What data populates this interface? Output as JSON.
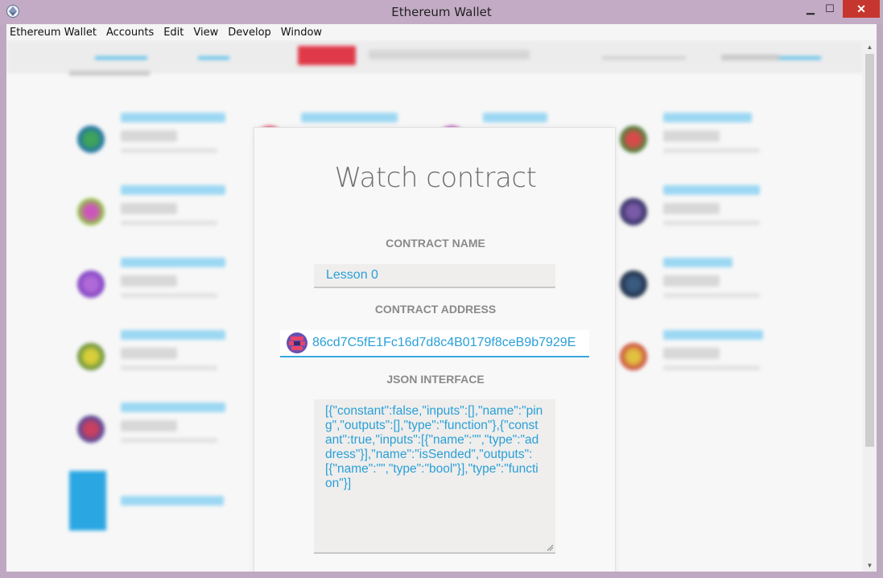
{
  "window": {
    "title": "Ethereum Wallet",
    "minimize_glyph": "▁",
    "maximize_glyph": "☐",
    "close_glyph": "✕"
  },
  "menu": [
    "Ethereum Wallet",
    "Accounts",
    "Edit",
    "View",
    "Develop",
    "Window"
  ],
  "modal": {
    "title": "Watch contract",
    "contract_name_label": "CONTRACT NAME",
    "contract_name_value": "Lesson 0",
    "contract_address_label": "CONTRACT ADDRESS",
    "contract_address_value": "86cd7C5fE1Fc16d7d8c4B0179f8ceB9b7929E",
    "json_interface_label": "JSON INTERFACE",
    "json_interface_value": "[{\"constant\":false,\"inputs\":[],\"name\":\"ping\",\"outputs\":[],\"type\":\"function\"},{\"constant\":true,\"inputs\":[{\"name\":\"\",\"type\":\"address\"}],\"name\":\"isSended\",\"outputs\":[{\"name\":\"\",\"type\":\"bool\"}],\"type\":\"function\"}]"
  },
  "colors": {
    "accent": "#2a9fd8",
    "titlebar": "#c3abc5",
    "close": "#c7362e",
    "label": "#8a8a8a"
  },
  "icons": {
    "app": "ethereum-diamond-icon",
    "address": "identicon-icon",
    "scroll_up": "scroll-up-arrow-icon",
    "scroll_down": "scroll-down-arrow-icon"
  }
}
